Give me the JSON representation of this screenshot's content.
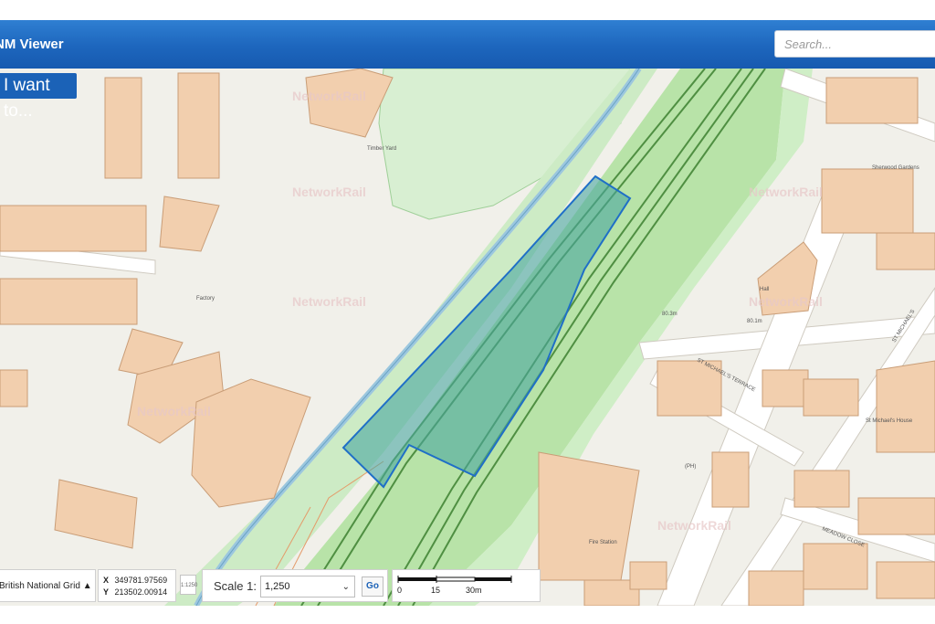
{
  "app": {
    "title": "NM Viewer"
  },
  "search": {
    "placeholder": "Search..."
  },
  "iwant": {
    "label": "I want to..."
  },
  "map": {
    "labels": {
      "timber_yard": "Timber Yard",
      "factory": "Factory",
      "hall": "Hall",
      "fire_station": "Fire Station",
      "st_michaels_terrace": "ST MICHAEL'S TERRACE",
      "st_michaels_road": "ST MICHAEL'S",
      "meadow_close": "MEADOW CLOSE",
      "st_michaels_house": "St Michael's House",
      "level1": "80.3m",
      "level2": "80.1m",
      "ph": "(PH)",
      "sherwood_gardens": "Sherwood Gardens",
      "watermark": "NetworkRail"
    },
    "colors": {
      "rail_corridor": "#b8e3a8",
      "selection_fill": "#4aa7a0",
      "selection_stroke": "#1f6fc7",
      "building": "#f2cfae"
    }
  },
  "status": {
    "crs_label": "British National Grid ▲",
    "x_label": "X",
    "x_value": "349781.97569",
    "y_label": "Y",
    "y_value": "213502.00914",
    "zoom_icon": "1:1250",
    "scale_label": "Scale 1:",
    "scale_value": "1,250",
    "go_label": "Go",
    "scalebar_ticks": [
      "0",
      "15",
      "30m"
    ]
  }
}
